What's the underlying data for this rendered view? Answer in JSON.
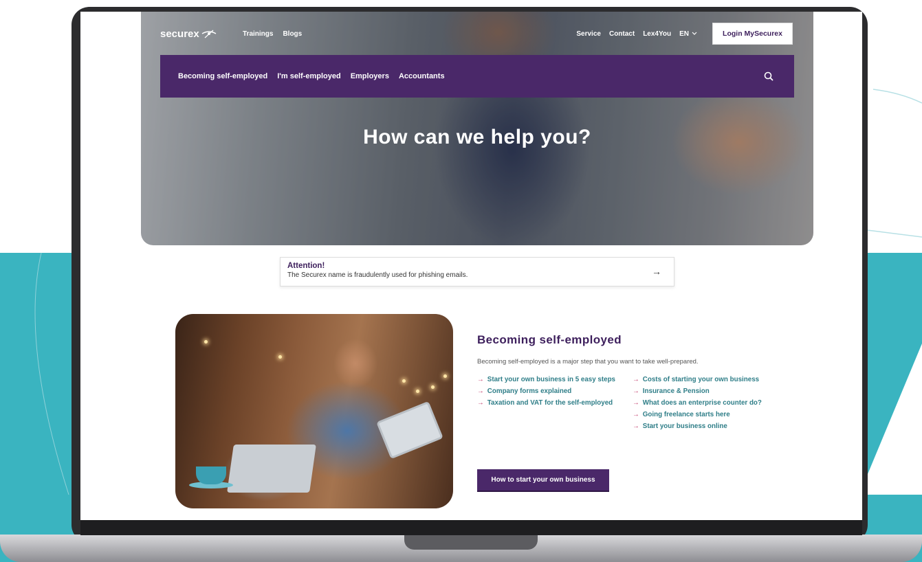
{
  "colors": {
    "brand_purple": "#4a2869",
    "teal_background": "#3ab4c0",
    "link_teal": "#2f7e88",
    "arrow_pink": "#c13a6a"
  },
  "logo": {
    "text": "securex"
  },
  "topnav": {
    "left_links": [
      "Trainings",
      "Blogs"
    ],
    "right_links": [
      "Service",
      "Contact",
      "Lex4You"
    ],
    "language": "EN",
    "login_label": "Login MySecurex"
  },
  "mainnav": {
    "items": [
      "Becoming self-employed",
      "I'm self-employed",
      "Employers",
      "Accountants"
    ],
    "search_icon": "search-icon"
  },
  "hero": {
    "title": "How can we help you?"
  },
  "attention": {
    "title": "Attention!",
    "text": "The Securex name is fraudulently used for phishing emails.",
    "arrow": "→"
  },
  "section": {
    "title": "Becoming self-employed",
    "description": "Becoming self-employed is a major step that you want to take well-prepared.",
    "left_links": [
      "Start your own business in 5 easy steps",
      "Company forms explained",
      "Taxation and VAT for the self-employed"
    ],
    "right_links": [
      "Costs of starting your own business",
      "Insurance & Pension",
      "What does an enterprise counter do?",
      "Going freelance starts here",
      "Start your business online"
    ],
    "cta_label": "How to start your own business",
    "link_arrow": "→"
  }
}
